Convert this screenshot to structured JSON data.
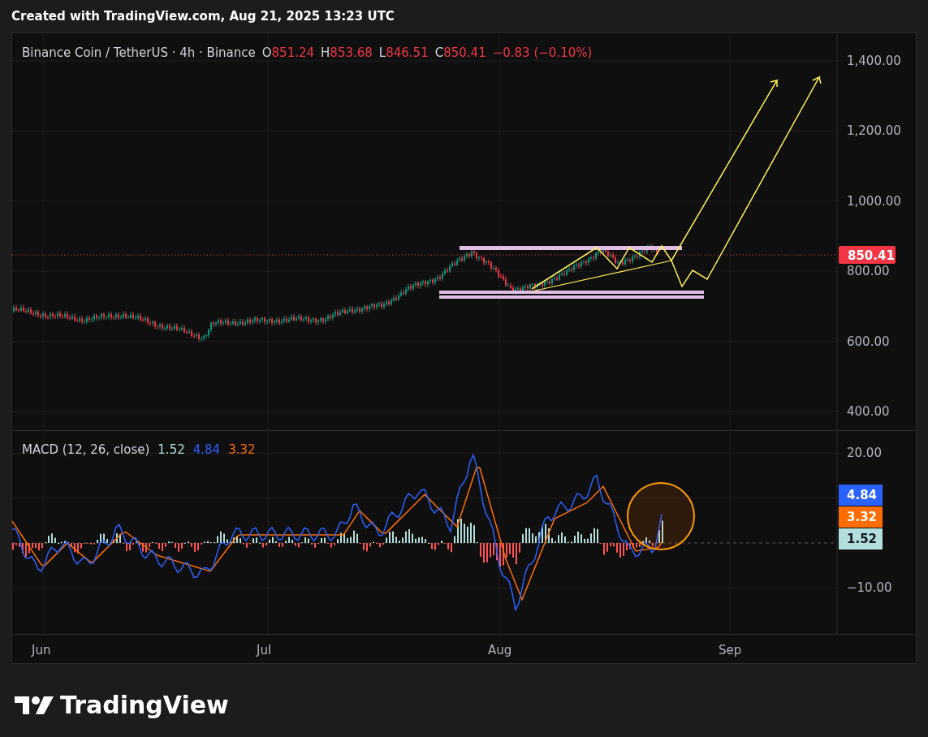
{
  "header": {
    "title": "Created with TradingView.com, Aug 21, 2025 13:23 UTC"
  },
  "legend": {
    "symbol": "Binance Coin / TetherUS · 4h · Binance",
    "ohlc": [
      {
        "label": "O",
        "value": "851.24"
      },
      {
        "label": "H",
        "value": "853.68"
      },
      {
        "label": "L",
        "value": "846.51"
      },
      {
        "label": "C",
        "value": "850.41"
      }
    ],
    "change": "−0.83 (−0.10%)"
  },
  "price_axis": [
    "1,400.00",
    "1,200.00",
    "1,000.00",
    "800.00",
    "600.00",
    "400.00"
  ],
  "last_price": "850.41",
  "macd": {
    "title": "MACD (12, 26, close)",
    "values": [
      {
        "text": "1.52",
        "color": "#b2dfdb"
      },
      {
        "text": "4.84",
        "color": "#2962ff"
      },
      {
        "text": "3.32",
        "color": "#ff6d00"
      }
    ]
  },
  "macd_axis": [
    "20.00",
    "−10.00"
  ],
  "macd_badges": [
    {
      "text": "4.84",
      "color": "#2962ff"
    },
    {
      "text": "3.32",
      "color": "#ff6d00"
    },
    {
      "text": "1.52",
      "color": "#b2dfdb"
    }
  ],
  "time_axis": [
    "Jun",
    "Jul",
    "Aug",
    "Sep"
  ],
  "brand": {
    "name": "TradingView"
  }
}
